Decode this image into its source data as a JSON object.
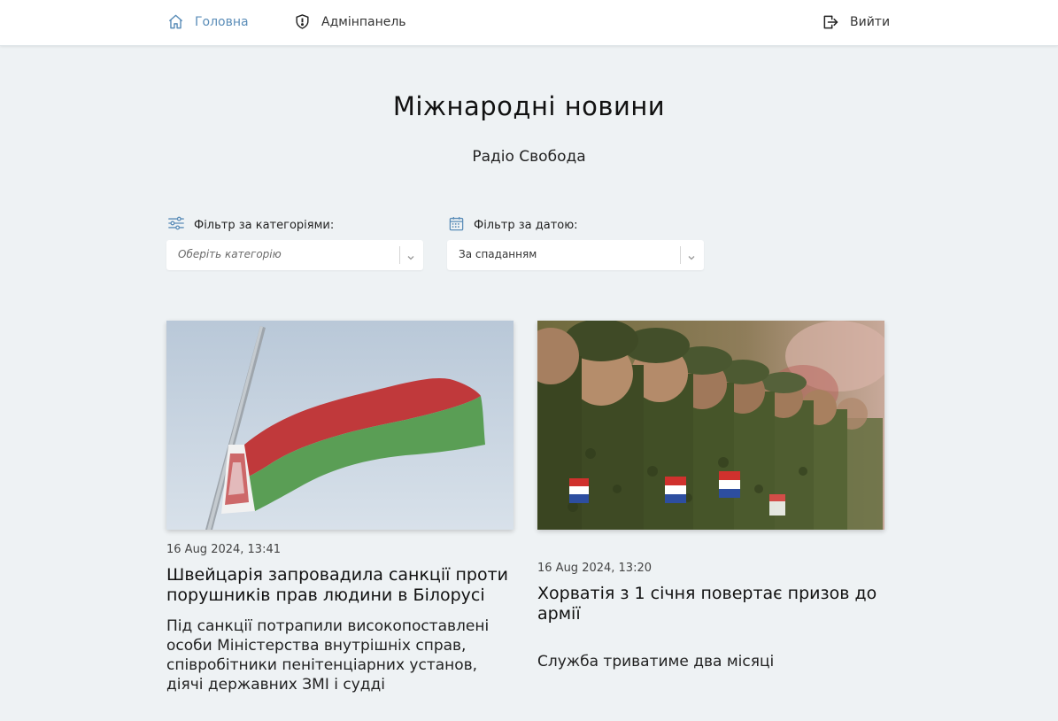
{
  "nav": {
    "home_label": "Головна",
    "admin_label": "Адмінпанель",
    "logout_label": "Вийти",
    "accent_color": "#5b8db8"
  },
  "page": {
    "title": "Міжнародні новини",
    "subtitle": "Радіо Свобода"
  },
  "filters": {
    "category": {
      "label": "Фільтр за категоріями:",
      "placeholder": "Оберіть категорію",
      "icon": "sliders-icon"
    },
    "date": {
      "label": "Фільтр за датою:",
      "value": "За спаданням",
      "icon": "calendar-icon"
    }
  },
  "articles": [
    {
      "date": "16 Aug 2024, 13:41",
      "title": "Швейцарія запровадила санкції проти порушників прав людини в Білорусі",
      "description": "Під санкції потрапили високопоставлені особи Міністерства внутрішніх справ, співробітники пенітенціарних установ, діячі державних ЗМІ і судді"
    },
    {
      "date": "16 Aug 2024, 13:20",
      "title": "Хорватія з 1 січня повертає призов до армії",
      "description": "Служба триватиме два місяці"
    }
  ]
}
